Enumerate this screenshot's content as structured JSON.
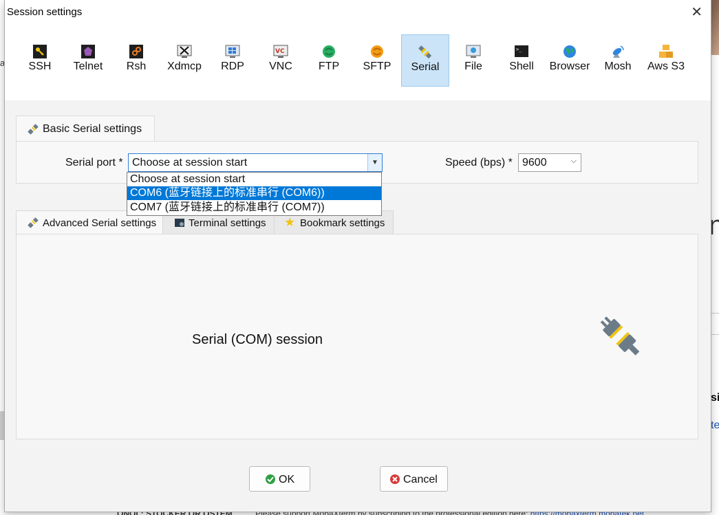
{
  "dialog": {
    "title": "Session settings",
    "close_glyph": "✕"
  },
  "session_types": [
    {
      "label": "SSH",
      "icon": "key-icon",
      "color": "#e7a800"
    },
    {
      "label": "Telnet",
      "icon": "telnet-icon",
      "color": "#8e44ad"
    },
    {
      "label": "Rsh",
      "icon": "rsh-icon",
      "color": "#e67e22"
    },
    {
      "label": "Xdmcp",
      "icon": "xdmcp-icon",
      "color": "#555555"
    },
    {
      "label": "RDP",
      "icon": "rdp-icon",
      "color": "#2f7bd6"
    },
    {
      "label": "VNC",
      "icon": "vnc-icon",
      "color": "#c0392b"
    },
    {
      "label": "FTP",
      "icon": "ftp-icon",
      "color": "#27ae60"
    },
    {
      "label": "SFTP",
      "icon": "sftp-icon",
      "color": "#f39c12"
    },
    {
      "label": "Serial",
      "icon": "serial-plug-icon",
      "color": "#5d7485",
      "active": true
    },
    {
      "label": "File",
      "icon": "file-monitor-icon",
      "color": "#3a9ad9"
    },
    {
      "label": "Shell",
      "icon": "terminal-icon",
      "color": "#222222"
    },
    {
      "label": "Browser",
      "icon": "globe-icon",
      "color": "#2e86de"
    },
    {
      "label": "Mosh",
      "icon": "satellite-icon",
      "color": "#2e86de"
    },
    {
      "label": "Aws S3",
      "icon": "aws-boxes-icon",
      "color": "#f5b43a"
    }
  ],
  "basic": {
    "tab_label": "Basic Serial settings",
    "port_label": "Serial port *",
    "port_value": "Choose at session start",
    "speed_label": "Speed (bps) *",
    "speed_value": "9600"
  },
  "dropdown": {
    "options": [
      "Choose at session start",
      "COM6  (蓝牙链接上的标准串行 (COM6))",
      "COM7  (蓝牙链接上的标准串行 (COM7))"
    ],
    "selected_index": 1
  },
  "lower_tabs": [
    {
      "label": "Advanced Serial settings",
      "icon": "plug-icon"
    },
    {
      "label": "Terminal settings",
      "icon": "terminal-settings-icon"
    },
    {
      "label": "Bookmark settings",
      "icon": "star-icon"
    }
  ],
  "panel": {
    "caption": "Serial (COM) session"
  },
  "buttons": {
    "ok": "OK",
    "cancel": "Cancel"
  },
  "background": {
    "letter_a": "a",
    "letter_n": "n",
    "text_si": "si",
    "text_te": "te",
    "bottom_bold": "ONOL: STOCKER OR OSTEM",
    "bottom_text": "Please support MobaXterm by subscribing to the professional edition here:",
    "bottom_link": "https://mobaxterm.mobatek.net"
  }
}
